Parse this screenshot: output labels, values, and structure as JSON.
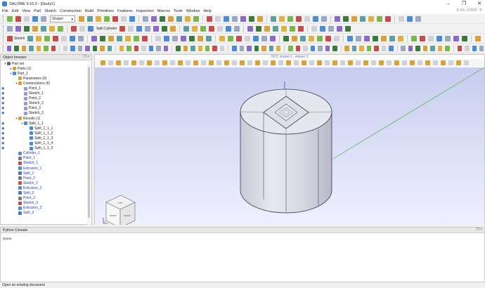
{
  "window": {
    "title": "SALOME 9.16.0 - [Study1]"
  },
  "logo_text": "SALOME 9",
  "menu": [
    "File",
    "Edit",
    "View",
    "Part",
    "Sketch",
    "Construction",
    "Build",
    "Primitives",
    "Features",
    "Inspection",
    "Macros",
    "Tools",
    "Window",
    "Help"
  ],
  "toolbar1": {
    "module_combo": "Shaper"
  },
  "toolbar2": {
    "split_cylinder_label": "Split Cylinder"
  },
  "toolbar3": {
    "sketch_label": "Sketch"
  },
  "object_browser": {
    "title": "Object browser",
    "header_buttons": "❐ ×",
    "rows": [
      {
        "label": "Part set",
        "level": 0,
        "expand": "▾",
        "color": "#1a1a1a",
        "icon": "part-set",
        "eye": false
      },
      {
        "label": "Parts (1)",
        "level": 1,
        "expand": "▸",
        "color": "#1a1a1a",
        "icon": "folder",
        "eye": false
      },
      {
        "label": "Part_1",
        "level": 1,
        "expand": "▾",
        "color": "#1a1a1a",
        "icon": "part",
        "eye": false
      },
      {
        "label": "Parameters (0)",
        "level": 2,
        "expand": "",
        "color": "#1a1a1a",
        "icon": "folder",
        "eye": false
      },
      {
        "label": "Constructions (6)",
        "level": 2,
        "expand": "▾",
        "color": "#1a1a1a",
        "icon": "folder",
        "eye": false
      },
      {
        "label": "Point_1",
        "level": 3,
        "expand": "",
        "color": "#1a1a1a",
        "icon": "construction",
        "eye": true
      },
      {
        "label": "Sketch_1",
        "level": 3,
        "expand": "",
        "color": "#1a1a1a",
        "icon": "construction",
        "eye": true
      },
      {
        "label": "Point_2",
        "level": 3,
        "expand": "",
        "color": "#1a1a1a",
        "icon": "construction",
        "eye": true
      },
      {
        "label": "Sketch_2",
        "level": 3,
        "expand": "",
        "color": "#1a1a1a",
        "icon": "construction",
        "eye": true
      },
      {
        "label": "Point_3",
        "level": 3,
        "expand": "",
        "color": "#1a1a1a",
        "icon": "construction",
        "eye": true
      },
      {
        "label": "Sketch_3",
        "level": 3,
        "expand": "",
        "color": "#1a1a1a",
        "icon": "construction",
        "eye": true
      },
      {
        "label": "Results (1)",
        "level": 2,
        "expand": "▾",
        "color": "#1a1a1a",
        "icon": "folder",
        "eye": false
      },
      {
        "label": "Split_1_1",
        "level": 3,
        "expand": "▾",
        "color": "#1a1a1a",
        "icon": "result",
        "eye": true
      },
      {
        "label": "Split_1_1_1",
        "level": 4,
        "expand": "",
        "color": "#1a1a1a",
        "icon": "result",
        "eye": true
      },
      {
        "label": "Split_1_1_2",
        "level": 4,
        "expand": "",
        "color": "#1a1a1a",
        "icon": "result",
        "eye": true
      },
      {
        "label": "Split_1_1_3",
        "level": 4,
        "expand": "",
        "color": "#1a1a1a",
        "icon": "result",
        "eye": true
      },
      {
        "label": "Split_1_1_4",
        "level": 4,
        "expand": "",
        "color": "#1a1a1a",
        "icon": "result",
        "eye": true
      },
      {
        "label": "Split_1_1_5",
        "level": 4,
        "expand": "",
        "color": "#1a1a1a",
        "icon": "result",
        "eye": true
      },
      {
        "label": "Cylinder_1",
        "level": 2,
        "expand": "",
        "color": "#1c3fb0",
        "icon": "feature",
        "eye": false
      },
      {
        "label": "Point_1",
        "level": 2,
        "expand": "",
        "color": "#1c3fb0",
        "icon": "point",
        "eye": false
      },
      {
        "label": "Sketch_1",
        "level": 2,
        "expand": "",
        "color": "#1c3fb0",
        "icon": "sketch",
        "eye": false
      },
      {
        "label": "Extrusion_1",
        "level": 2,
        "expand": "",
        "color": "#1c3fb0",
        "icon": "feature",
        "eye": false
      },
      {
        "label": "Split_1",
        "level": 2,
        "expand": "",
        "color": "#1c3fb0",
        "icon": "split",
        "eye": false
      },
      {
        "label": "Point_2",
        "level": 2,
        "expand": "",
        "color": "#1c3fb0",
        "icon": "point",
        "eye": false
      },
      {
        "label": "Sketch_2",
        "level": 2,
        "expand": "",
        "color": "#1c3fb0",
        "icon": "sketch",
        "eye": false
      },
      {
        "label": "Extrusion_2",
        "level": 2,
        "expand": "",
        "color": "#1c3fb0",
        "icon": "feature",
        "eye": false
      },
      {
        "label": "Split_2",
        "level": 2,
        "expand": "",
        "color": "#1c3fb0",
        "icon": "split",
        "eye": false
      },
      {
        "label": "Point_3",
        "level": 2,
        "expand": "",
        "color": "#1c3fb0",
        "icon": "point",
        "eye": false
      },
      {
        "label": "Sketch_3",
        "level": 2,
        "expand": "",
        "color": "#1c3fb0",
        "icon": "sketch",
        "eye": false
      },
      {
        "label": "Extrusion_3",
        "level": 2,
        "expand": "",
        "color": "#1c3fb0",
        "icon": "feature",
        "eye": false
      },
      {
        "label": "Split_3",
        "level": 2,
        "expand": "",
        "color": "#1c3fb0",
        "icon": "split",
        "eye": false
      }
    ]
  },
  "viewer": {
    "title": "OCC scene:1 - viewer:1",
    "background_top": "#c8cdef",
    "background_bottom": "#eef0ff",
    "shape_color": "#e2e2ec",
    "navcube": {
      "faces": [
        "TOP",
        "FRONT",
        "RIGHT"
      ]
    }
  },
  "python_console": {
    "title": "Python Console",
    "prompt": ">>>",
    "header_buttons": "❐ ×"
  },
  "status": {
    "text": "Open an existing document"
  },
  "colors": {
    "accent": "#1f57c1",
    "feature_text": "#1c3fb0",
    "axis_x": "#4cb84c",
    "axis_z": "#3030c8"
  }
}
